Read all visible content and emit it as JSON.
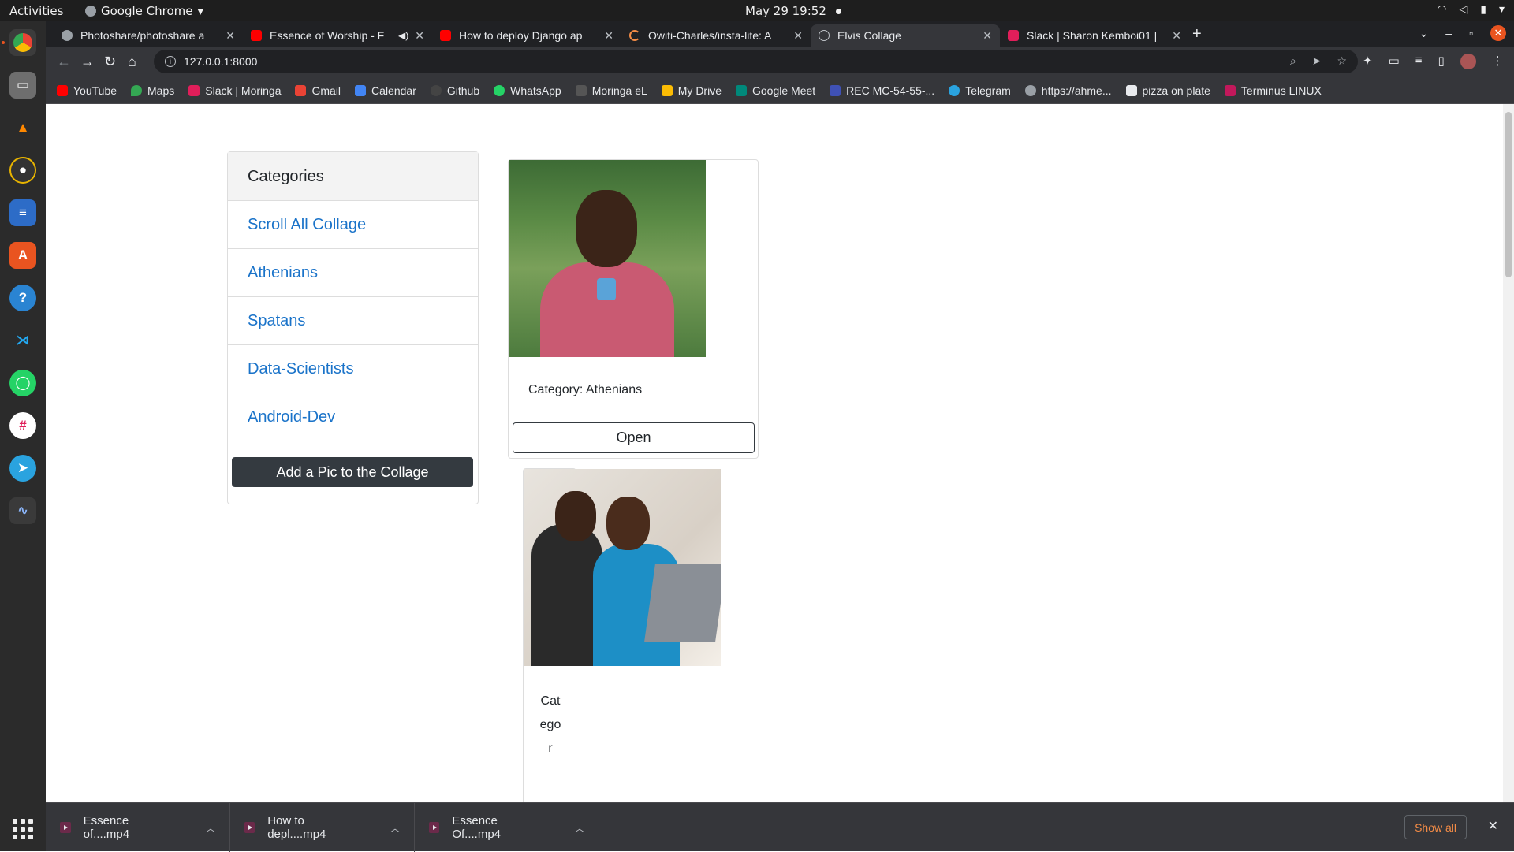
{
  "system": {
    "activities": "Activities",
    "app_menu": "Google Chrome",
    "clock": "May 29  19:52"
  },
  "browser": {
    "tabs": [
      {
        "title": "Photoshare/photoshare a",
        "fav_color": "#9aa0a6"
      },
      {
        "title": "Essence of Worship - F",
        "fav_color": "#ff0000"
      },
      {
        "title": "How to deploy Django ap",
        "fav_color": "#ff0000"
      },
      {
        "title": "Owiti-Charles/insta-lite: A",
        "fav_color": "#f28b46"
      },
      {
        "title": "Elvis Collage",
        "fav_color": "#bdc1c6"
      },
      {
        "title": "Slack | Sharon Kemboi01 |",
        "fav_color": "#e01e5a"
      }
    ],
    "address": "127.0.0.1:8000",
    "bookmarks": [
      {
        "label": "YouTube",
        "color": "#ff0000"
      },
      {
        "label": "Maps",
        "color": "#34a853"
      },
      {
        "label": "Slack | Moringa",
        "color": "#e01e5a"
      },
      {
        "label": "Gmail",
        "color": "#ea4335"
      },
      {
        "label": "Calendar",
        "color": "#4285f4"
      },
      {
        "label": "Github",
        "color": "#444"
      },
      {
        "label": "WhatsApp",
        "color": "#25d366"
      },
      {
        "label": "Moringa eL",
        "color": "#555"
      },
      {
        "label": "My Drive",
        "color": "#fbbc04"
      },
      {
        "label": "Google Meet",
        "color": "#00897b"
      },
      {
        "label": "REC MC-54-55-...",
        "color": "#3f51b5"
      },
      {
        "label": "Telegram",
        "color": "#2aa3df"
      },
      {
        "label": "https://ahme...",
        "color": "#9aa0a6"
      },
      {
        "label": "pizza on plate",
        "color": "#e8eaed"
      },
      {
        "label": "Terminus LINUX",
        "color": "#c2185b"
      }
    ]
  },
  "sidebar": {
    "heading": "Categories",
    "items": [
      "Scroll All Collage",
      "Athenians",
      "Spatans",
      "Data-Scientists",
      "Android-Dev"
    ],
    "add_button": "Add a Pic to the Collage"
  },
  "cards": [
    {
      "category_text": "Category: Athenians",
      "open_label": "Open"
    },
    {
      "category_text": "Categor"
    }
  ],
  "downloads": {
    "items": [
      "Essence of....mp4",
      "How to depl....mp4",
      "Essence Of....mp4"
    ],
    "show_all": "Show all"
  }
}
